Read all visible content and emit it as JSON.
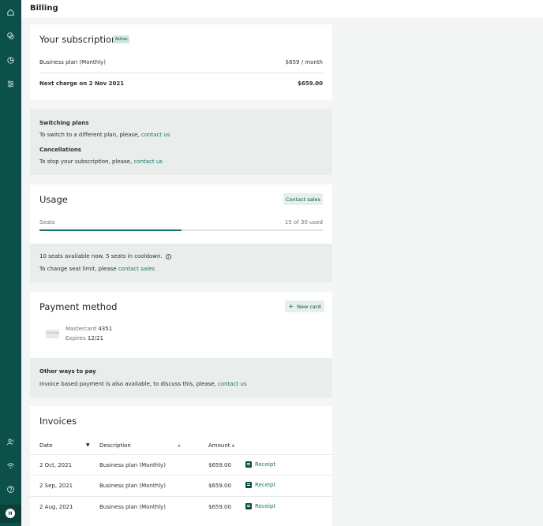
{
  "header": {
    "title": "Billing"
  },
  "sidebar": {
    "icons": [
      "home-icon",
      "chat-icon",
      "pie-chart-icon",
      "sliders-icon",
      "users-icon",
      "wifi-icon",
      "help-icon"
    ],
    "avatar_initial": "H"
  },
  "subscription": {
    "title": "Your subscription",
    "status": "Active",
    "plan_label": "Business plan (Monthly)",
    "plan_price": "$659 / month",
    "next_charge_label": "Next charge on 2 Nov 2021",
    "next_charge_amount": "$659.00"
  },
  "plan_info": {
    "switching_title": "Switching plans",
    "switching_text": "To switch to a different plan, please,",
    "switching_link": "contact us",
    "cancel_title": "Cancellations",
    "cancel_text": "To stop your subscription, please,",
    "cancel_link": "contact us"
  },
  "usage": {
    "title": "Usage",
    "contact_button": "Contact sales",
    "seats_label": "Seats",
    "seats_used_text": "15 of 30 used",
    "seats_used": 15,
    "seats_total": 30,
    "availability_text": "10 seats available now. 5 seats in cooldown.",
    "limit_text": "To change seat limit, please",
    "limit_link": "contact sales"
  },
  "payment": {
    "title": "Payment method",
    "new_card_button": "New card",
    "card_brand": "Mastercard",
    "card_last4": "4351",
    "expires_label": "Expires",
    "expires_value": "12/21",
    "other_title": "Other ways to pay",
    "other_text": "Invoice based payment is also available, to discuss this, please,",
    "other_link": "contact us"
  },
  "invoices": {
    "title": "Invoices",
    "columns": {
      "date": "Date",
      "description": "Description",
      "amount": "Amount"
    },
    "receipt_label": "Receipt",
    "rows": [
      {
        "date": "2 Oct, 2021",
        "description": "Business plan (Monthly)",
        "amount": "$659.00"
      },
      {
        "date": "2 Sep, 2021",
        "description": "Business plan (Monthly)",
        "amount": "$659.00"
      },
      {
        "date": "2 Aug, 2021",
        "description": "Business plan (Monthly)",
        "amount": "$659.00"
      }
    ]
  }
}
